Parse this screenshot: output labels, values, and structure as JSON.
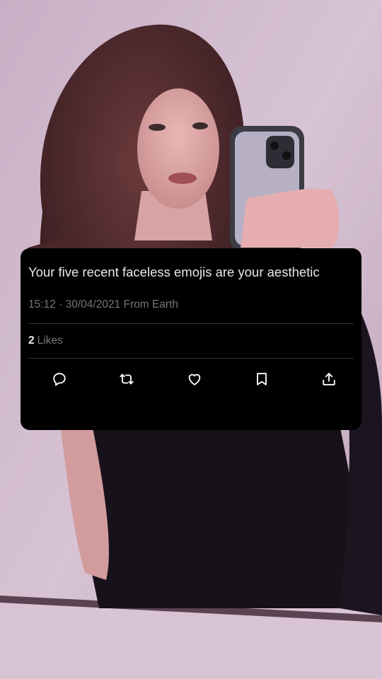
{
  "tweet": {
    "text": "Your five recent faceless emojis are your aesthetic",
    "time": "15:12",
    "separator": "·",
    "date": "30/04/2021",
    "source": "From Earth",
    "likes_count": "2",
    "likes_label": "Likes"
  },
  "actions": {
    "reply_icon": "reply-bubble-icon",
    "retweet_icon": "retweet-icon",
    "like_icon": "heart-icon",
    "bookmark_icon": "bookmark-icon",
    "share_icon": "share-upload-icon"
  },
  "colors": {
    "card_background": "#000000",
    "primary_text": "#e7e9ea",
    "secondary_text": "#71767b",
    "divider": "#2f3336",
    "icon": "#ffffff"
  }
}
